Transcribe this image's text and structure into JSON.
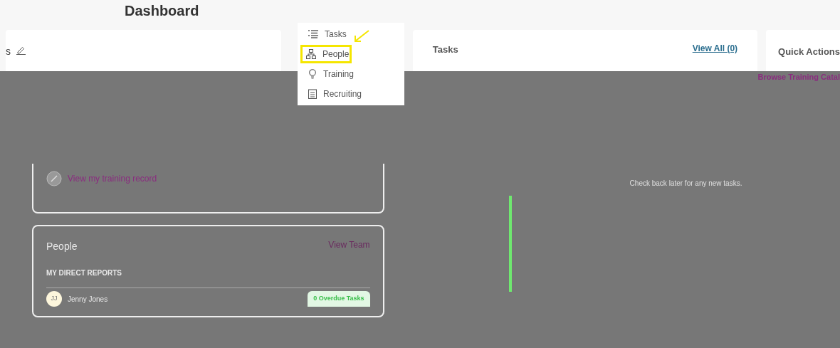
{
  "header": {
    "title": "Dashboard"
  },
  "links_card": {
    "title": "s",
    "link": "View my training record"
  },
  "people_card": {
    "title": "People",
    "link": "View Team",
    "section": "MY DIRECT REPORTS",
    "reports": [
      {
        "initials": "JJ",
        "name": "Jenny Jones",
        "badge": "0 Overdue Tasks"
      }
    ]
  },
  "tasks_card": {
    "title": "Tasks",
    "link": "View All (0)",
    "empty_message": "Check back later for any new tasks."
  },
  "quick_actions": {
    "title": "Quick Actions",
    "actions": [
      "Browse Training Catal"
    ]
  },
  "menu": {
    "items": [
      {
        "label": "Tasks",
        "selected": false
      },
      {
        "label": "People",
        "selected": true
      },
      {
        "label": "Training",
        "selected": false
      },
      {
        "label": "Recruiting",
        "selected": false
      }
    ]
  }
}
